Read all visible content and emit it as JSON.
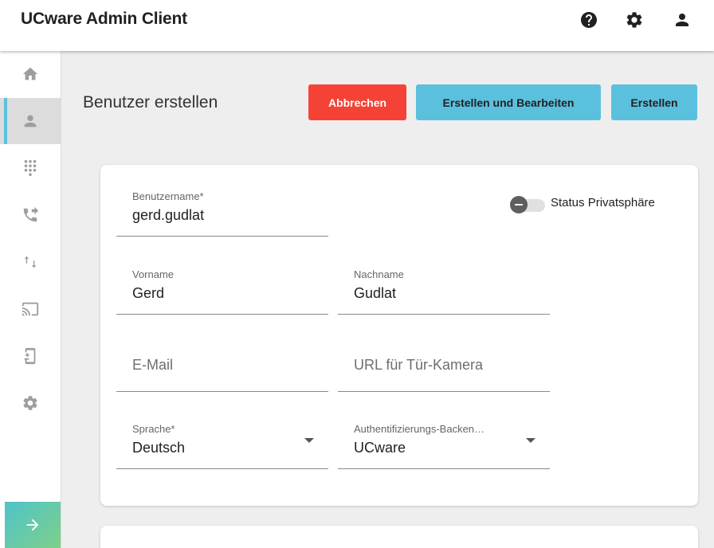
{
  "app": {
    "title": "UCware Admin Client"
  },
  "top_icons": [
    "help-icon",
    "gear-icon",
    "account-icon"
  ],
  "sidebar": {
    "items": [
      {
        "name": "home",
        "icon": "home-icon",
        "active": false
      },
      {
        "name": "users",
        "icon": "person-icon",
        "active": true
      },
      {
        "name": "dialpad",
        "icon": "dialpad-icon",
        "active": false
      },
      {
        "name": "call-forwarding",
        "icon": "phone-forward-icon",
        "active": false
      },
      {
        "name": "routing",
        "icon": "swap-vertical-icon",
        "active": false
      },
      {
        "name": "cast",
        "icon": "cast-icon",
        "active": false
      },
      {
        "name": "devices",
        "icon": "device-settings-icon",
        "active": false
      },
      {
        "name": "settings",
        "icon": "gear-icon",
        "active": false
      }
    ],
    "expand_icon": "arrow-right-icon"
  },
  "page": {
    "title": "Benutzer erstellen",
    "buttons": {
      "cancel": "Abbrechen",
      "create_and_edit": "Erstellen und Bearbeiten",
      "create": "Erstellen"
    }
  },
  "form": {
    "username": {
      "label": "Benutzername*",
      "value": "gerd.gudlat"
    },
    "privacy_toggle": {
      "label": "Status Privatsphäre",
      "checked": false
    },
    "firstname": {
      "label": "Vorname",
      "value": "Gerd"
    },
    "lastname": {
      "label": "Nachname",
      "value": "Gudlat"
    },
    "email": {
      "placeholder": "E-Mail"
    },
    "door_camera_url": {
      "placeholder": "URL für Tür-Kamera"
    },
    "language": {
      "label": "Sprache*",
      "value": "Deutsch"
    },
    "auth_backend": {
      "label": "Authentifizierungs-Backen…",
      "value": "UCware"
    }
  },
  "colors": {
    "cancel": "#f44336",
    "primary": "#5bc0de",
    "accent_gradient_start": "#4fc3c8",
    "accent_gradient_end": "#7ed08a"
  }
}
